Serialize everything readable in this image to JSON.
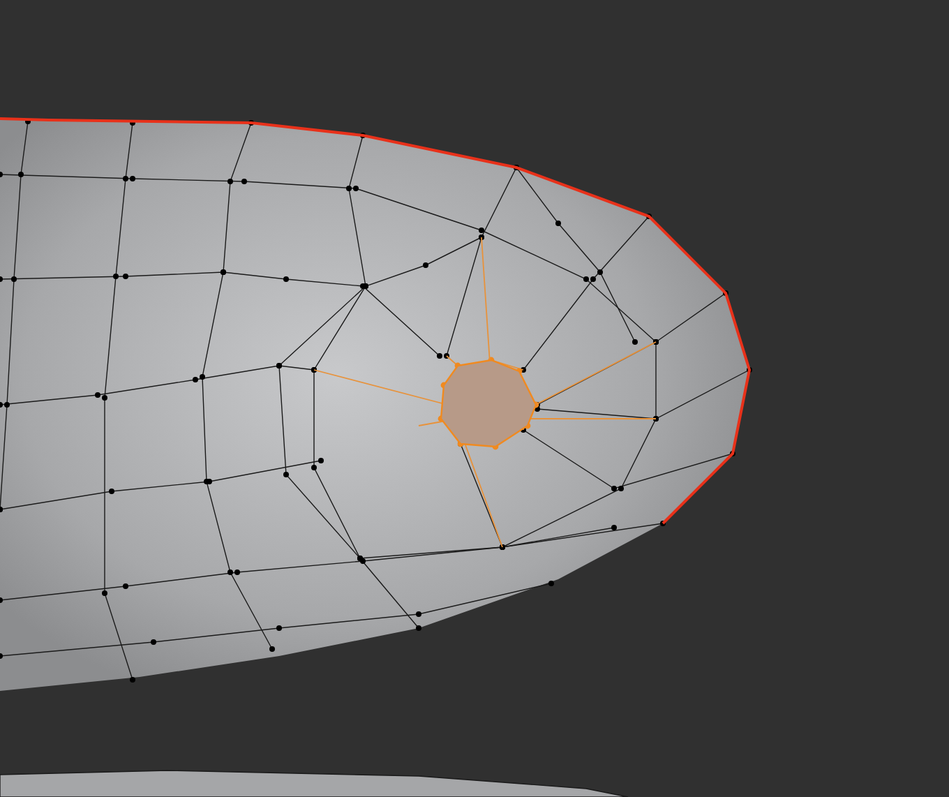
{
  "viewport": {
    "mesh": {
      "kind": "edit-mesh",
      "selected_face": true,
      "seam_edge": true
    }
  }
}
